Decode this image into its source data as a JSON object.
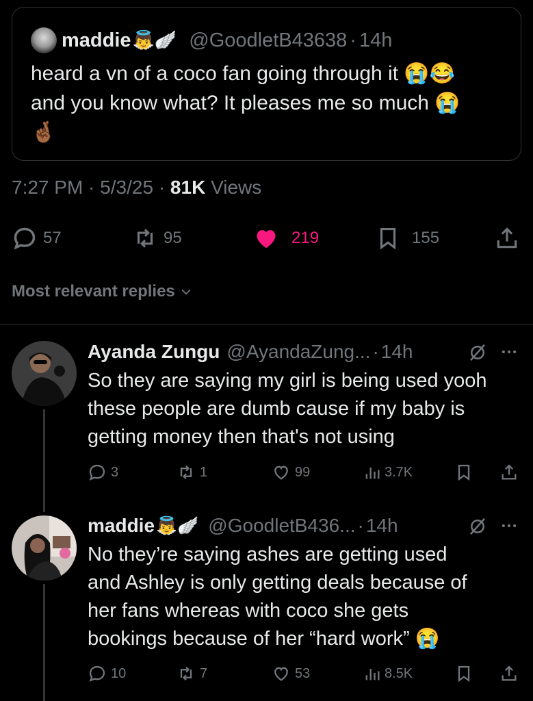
{
  "quoted_tweet": {
    "display_name": "maddie",
    "name_emojis": "👼🪽",
    "handle": "@GoodletB43638",
    "time_sep": "·",
    "time": "14h",
    "text_line1": "heard a vn of a coco fan going through it 😭😂",
    "text_line2": "and you know what? It pleases me so much 😭",
    "text_line3": "🤞🏾"
  },
  "main_tweet_meta": {
    "time": "7:27 PM",
    "sep1": "·",
    "date": "5/3/25",
    "sep2": "·",
    "views_count": "81K",
    "views_label": "Views"
  },
  "main_actions": {
    "replies": "57",
    "reposts": "95",
    "likes": "219",
    "bookmarks": "155",
    "like_color": "#f91880"
  },
  "sort": {
    "label": "Most relevant replies"
  },
  "replies": [
    {
      "display_name": "Ayanda Zungu",
      "handle": "@AyandaZung...",
      "time_sep": "·",
      "time": "14h",
      "lines": [
        "So they are saying my girl is being used yooh",
        "these people are dumb cause if my baby is",
        "getting money then that's not using"
      ],
      "replies": "3",
      "reposts": "1",
      "likes": "99",
      "views": "3.7K"
    },
    {
      "display_name": "maddie",
      "name_emojis": "👼🪽",
      "handle": "@GoodletB436...",
      "time_sep": "·",
      "time": "14h",
      "lines": [
        "No they’re saying ashes are getting used",
        "and Ashley is only getting deals because of",
        "her fans whereas with coco she gets",
        "bookings because of her “hard work” 😭"
      ],
      "replies": "10",
      "reposts": "7",
      "likes": "53",
      "views": "8.5K"
    }
  ],
  "colors": {
    "background": "#000000",
    "text": "#e7e9ea",
    "muted": "#71767b",
    "border": "#2f3336",
    "like_active": "#f91880"
  },
  "icons": [
    "reply-icon",
    "repost-icon",
    "like-icon",
    "bookmark-icon",
    "share-icon",
    "grok-icon",
    "more-icon",
    "views-icon",
    "chevron-down-icon"
  ]
}
